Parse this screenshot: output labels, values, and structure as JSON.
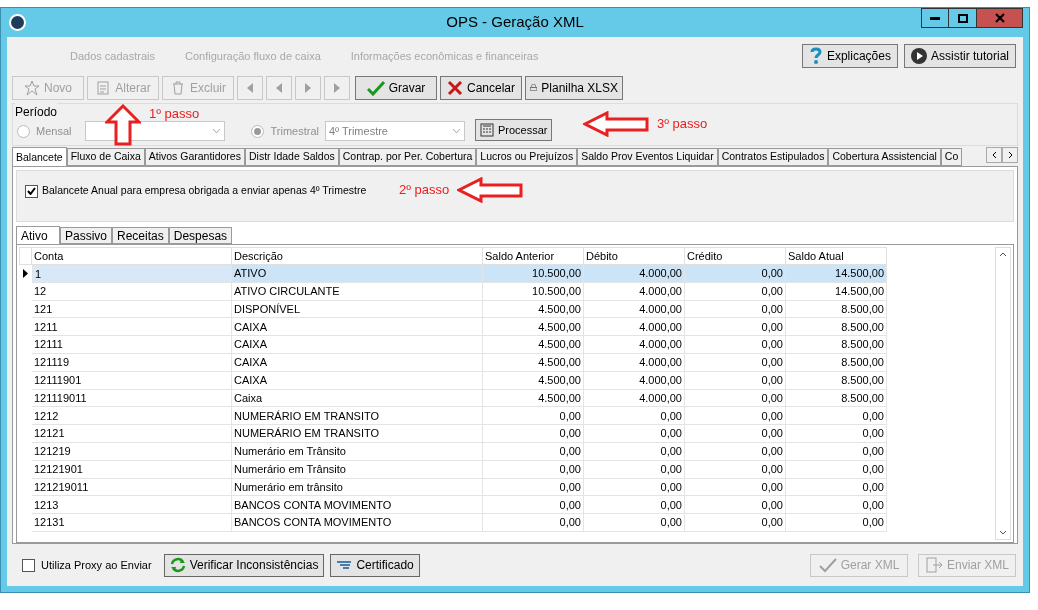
{
  "window": {
    "title": "OPS - Geração XML"
  },
  "nav_links": [
    {
      "label": "Dados cadastrais",
      "disabled": true
    },
    {
      "label": "Configuração fluxo de caixa",
      "disabled": true
    },
    {
      "label": "Informações econômicas e financeiras",
      "disabled": true
    }
  ],
  "help_buttons": [
    {
      "kind": "help",
      "label": "Explicações"
    },
    {
      "kind": "play",
      "label": "Assistir tutorial"
    }
  ],
  "toolbar": [
    {
      "kind": "new",
      "label": "Novo",
      "disabled": true
    },
    {
      "kind": "edit",
      "label": "Alterar",
      "disabled": true
    },
    {
      "kind": "delete",
      "label": "Excluir",
      "disabled": true
    },
    {
      "kind": "first",
      "disabled": true
    },
    {
      "kind": "prev",
      "disabled": true
    },
    {
      "kind": "next",
      "disabled": true
    },
    {
      "kind": "last",
      "disabled": true
    },
    {
      "kind": "save",
      "label": "Gravar",
      "disabled": false
    },
    {
      "kind": "cancel",
      "label": "Cancelar",
      "disabled": false
    },
    {
      "kind": "print",
      "label": "Planilha XLSX",
      "disabled": false
    }
  ],
  "period": {
    "label": "Período",
    "options": [
      {
        "label": "Mensal",
        "selected": false
      },
      {
        "label": "Trimestral",
        "selected": true,
        "value": "4º Trimestre"
      }
    ],
    "process_button": "Processar"
  },
  "tabs": [
    {
      "label": "Balancete",
      "selected": true
    },
    {
      "label": "Fluxo de Caixa",
      "selected": false
    },
    {
      "label": "Ativos Garantidores",
      "selected": false
    },
    {
      "label": "Distr Idade Saldos",
      "selected": false
    },
    {
      "label": "Contrap. por Per. Cobertura",
      "selected": false
    },
    {
      "label": "Lucros ou Prejuízos",
      "selected": false
    },
    {
      "label": "Saldo Prov Eventos Liquidar",
      "selected": false
    },
    {
      "label": "Contratos Estipulados",
      "selected": false
    },
    {
      "label": "Cobertura Assistencial",
      "selected": false
    },
    {
      "label": "Co",
      "selected": false
    }
  ],
  "annual_checkbox": {
    "label": "Balancete Anual para empresa obrigada a enviar apenas 4º Trimestre",
    "checked": true
  },
  "subtabs": [
    {
      "label": "Ativo",
      "selected": true
    },
    {
      "label": "Passivo",
      "selected": false
    },
    {
      "label": "Receitas",
      "selected": false
    },
    {
      "label": "Despesas",
      "selected": false
    }
  ],
  "table": {
    "columns": [
      "Conta",
      "Descrição",
      "Saldo Anterior",
      "Débito",
      "Crédito",
      "Saldo Atual"
    ],
    "rows": [
      {
        "selected": true,
        "cells": [
          "1",
          "ATIVO",
          "10.500,00",
          "4.000,00",
          "0,00",
          "14.500,00"
        ]
      },
      {
        "selected": false,
        "cells": [
          "12",
          "ATIVO CIRCULANTE",
          "10.500,00",
          "4.000,00",
          "0,00",
          "14.500,00"
        ]
      },
      {
        "selected": false,
        "cells": [
          "121",
          "DISPONÍVEL",
          "4.500,00",
          "4.000,00",
          "0,00",
          "8.500,00"
        ]
      },
      {
        "selected": false,
        "cells": [
          "1211",
          "CAIXA",
          "4.500,00",
          "4.000,00",
          "0,00",
          "8.500,00"
        ]
      },
      {
        "selected": false,
        "cells": [
          "12111",
          "CAIXA",
          "4.500,00",
          "4.000,00",
          "0,00",
          "8.500,00"
        ]
      },
      {
        "selected": false,
        "cells": [
          "121119",
          "CAIXA",
          "4.500,00",
          "4.000,00",
          "0,00",
          "8.500,00"
        ]
      },
      {
        "selected": false,
        "cells": [
          "12111901",
          "CAIXA",
          "4.500,00",
          "4.000,00",
          "0,00",
          "8.500,00"
        ]
      },
      {
        "selected": false,
        "cells": [
          "121119011",
          "Caixa",
          "4.500,00",
          "4.000,00",
          "0,00",
          "8.500,00"
        ]
      },
      {
        "selected": false,
        "cells": [
          "1212",
          "NUMERÁRIO EM TRANSITO",
          "0,00",
          "0,00",
          "0,00",
          "0,00"
        ]
      },
      {
        "selected": false,
        "cells": [
          "12121",
          "NUMERÁRIO EM TRANSITO",
          "0,00",
          "0,00",
          "0,00",
          "0,00"
        ]
      },
      {
        "selected": false,
        "cells": [
          "121219",
          "Numerário em Trânsito",
          "0,00",
          "0,00",
          "0,00",
          "0,00"
        ]
      },
      {
        "selected": false,
        "cells": [
          "12121901",
          "Numerário em Trânsito",
          "0,00",
          "0,00",
          "0,00",
          "0,00"
        ]
      },
      {
        "selected": false,
        "cells": [
          "121219011",
          "Numerário em trânsito",
          "0,00",
          "0,00",
          "0,00",
          "0,00"
        ]
      },
      {
        "selected": false,
        "cells": [
          "1213",
          "BANCOS CONTA MOVIMENTO",
          "0,00",
          "0,00",
          "0,00",
          "0,00"
        ]
      },
      {
        "selected": false,
        "cells": [
          "12131",
          "BANCOS CONTA MOVIMENTO",
          "0,00",
          "0,00",
          "0,00",
          "0,00"
        ]
      }
    ]
  },
  "footer": {
    "proxy_checkbox": {
      "label": "Utiliza Proxy ao Enviar",
      "checked": false
    },
    "buttons": [
      {
        "kind": "refresh",
        "label": "Verificar Inconsistências",
        "disabled": false
      },
      {
        "kind": "cert",
        "label": "Certificado",
        "disabled": false
      },
      {
        "kind": "gen",
        "label": "Gerar XML",
        "disabled": true
      },
      {
        "kind": "send",
        "label": "Enviar XML",
        "disabled": true
      }
    ]
  },
  "annotations": [
    {
      "kind": "up",
      "label": "1º passo"
    },
    {
      "kind": "left",
      "label": "2º passo"
    },
    {
      "kind": "left",
      "label": "3º passo"
    }
  ]
}
